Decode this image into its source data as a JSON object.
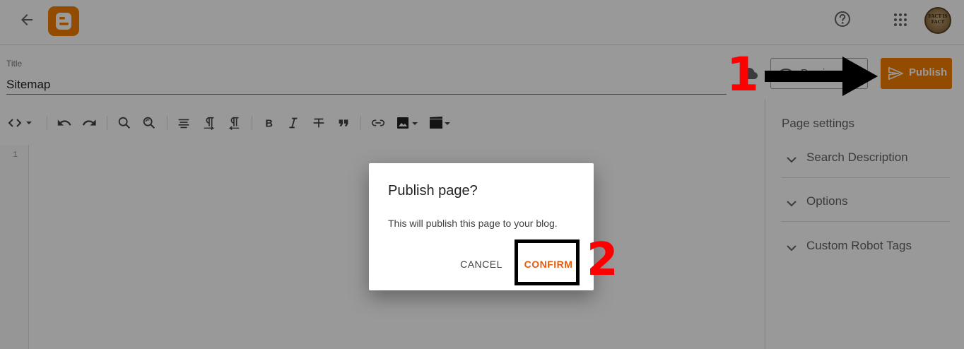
{
  "header": {
    "back_icon": "arrow-back-icon",
    "logo_icon": "blogger-logo-icon",
    "help_icon": "help-icon",
    "apps_icon": "apps-grid-icon",
    "avatar_text": "FACT IS FACT"
  },
  "editor": {
    "title_label": "Title",
    "title_value": "Sitemap",
    "preview_label": "Preview",
    "publish_label": "Publish",
    "line_number": "1",
    "toolbar": [
      "code-view-icon",
      "undo-icon",
      "redo-icon",
      "search-icon",
      "replace-icon",
      "align-icon",
      "ltr-icon",
      "rtl-icon",
      "bold-icon",
      "italic-icon",
      "strikethrough-icon",
      "quote-icon",
      "link-icon",
      "image-icon",
      "video-icon"
    ]
  },
  "sidebar": {
    "title": "Page settings",
    "items": [
      {
        "label": "Search Description"
      },
      {
        "label": "Options"
      },
      {
        "label": "Custom Robot Tags"
      }
    ]
  },
  "dialog": {
    "title": "Publish page?",
    "body": "This will publish this page to your blog.",
    "cancel_label": "CANCEL",
    "confirm_label": "CONFIRM"
  },
  "annotations": {
    "step1": "1",
    "step2": "2"
  },
  "colors": {
    "accent": "#f57d00",
    "confirm_text": "#e8590c",
    "annotation_red": "#ff0000"
  }
}
